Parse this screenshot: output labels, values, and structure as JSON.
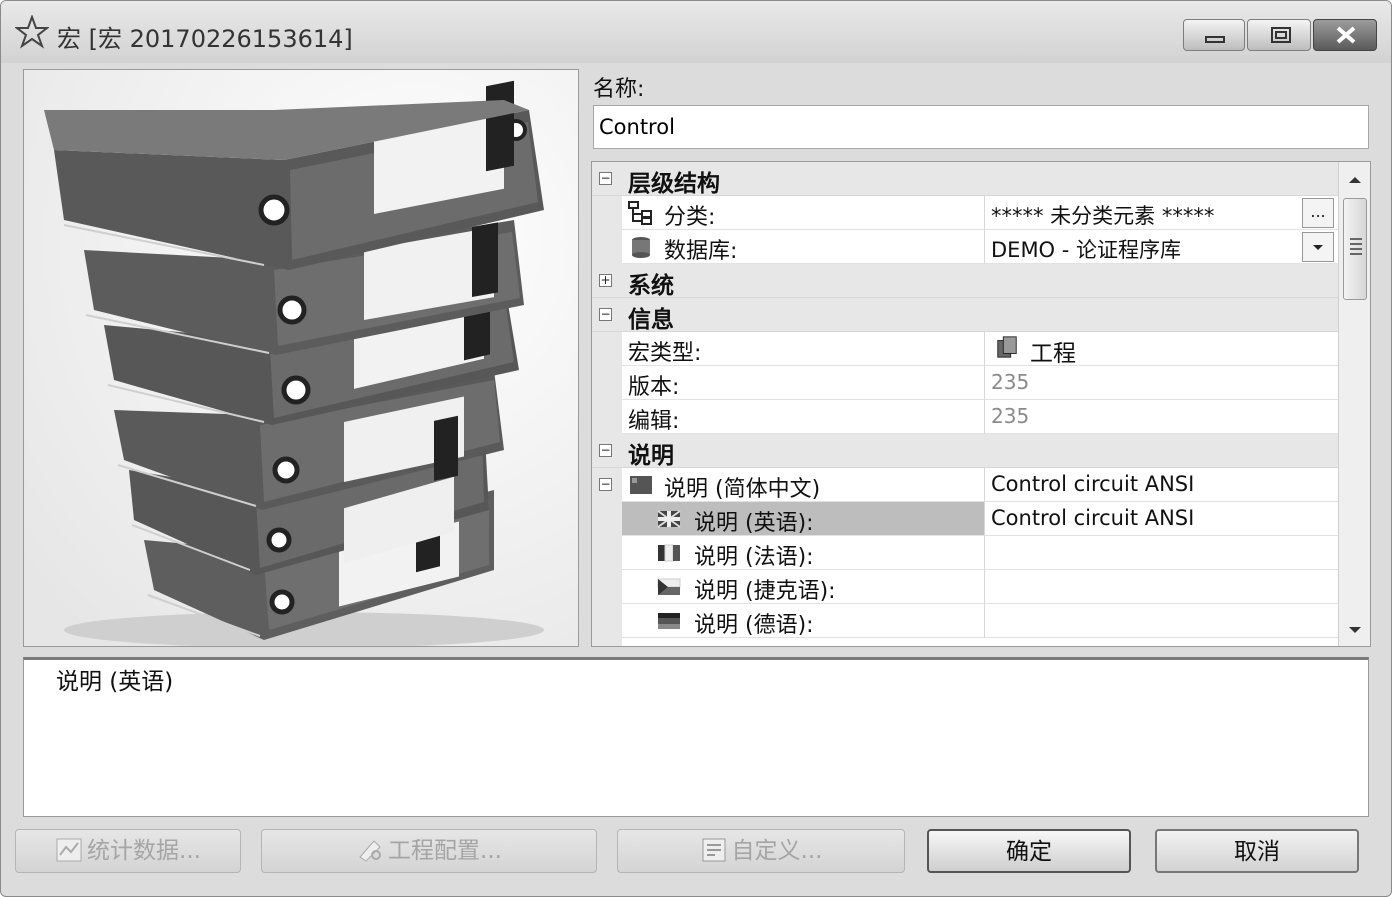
{
  "window": {
    "title": "宏 [宏 20170226153614]",
    "controls": {
      "minimize_icon": "minimize-icon",
      "maximize_icon": "restore-icon",
      "close_icon": "close-icon"
    }
  },
  "image": {
    "icon": "binders-stack-image"
  },
  "name": {
    "label": "名称:",
    "value": "Control"
  },
  "properties": {
    "hierarchy": {
      "label": "层级结构",
      "category": {
        "label": "分类:",
        "value": "***** 未分类元素 *****",
        "button": "..."
      },
      "database": {
        "label": "数据库:",
        "value": "DEMO - 论证程序库"
      }
    },
    "system": {
      "label": "系统"
    },
    "info": {
      "label": "信息",
      "macro_type": {
        "label": "宏类型:",
        "value": "工程"
      },
      "version": {
        "label": "版本:",
        "value": "235"
      },
      "edit": {
        "label": "编辑:",
        "value": "235"
      }
    },
    "description": {
      "label": "说明",
      "zh": {
        "label": "说明 (简体中文)",
        "value": "Control circuit ANSI"
      },
      "en": {
        "label": "说明 (英语):",
        "value": "Control circuit ANSI"
      },
      "fr": {
        "label": "说明 (法语):",
        "value": ""
      },
      "cs": {
        "label": "说明 (捷克语):",
        "value": ""
      },
      "de": {
        "label": "说明 (德语):",
        "value": ""
      }
    }
  },
  "description_panel": {
    "text": "说明 (英语)"
  },
  "buttons": {
    "statistics": "统计数据...",
    "project_config": "工程配置...",
    "custom": "自定义...",
    "ok": "确定",
    "cancel": "取消"
  },
  "colors": {
    "selected_row": "#bdbdbd",
    "section_bg": "#e7e7e7",
    "disabled_text": "#a5a5a5"
  }
}
